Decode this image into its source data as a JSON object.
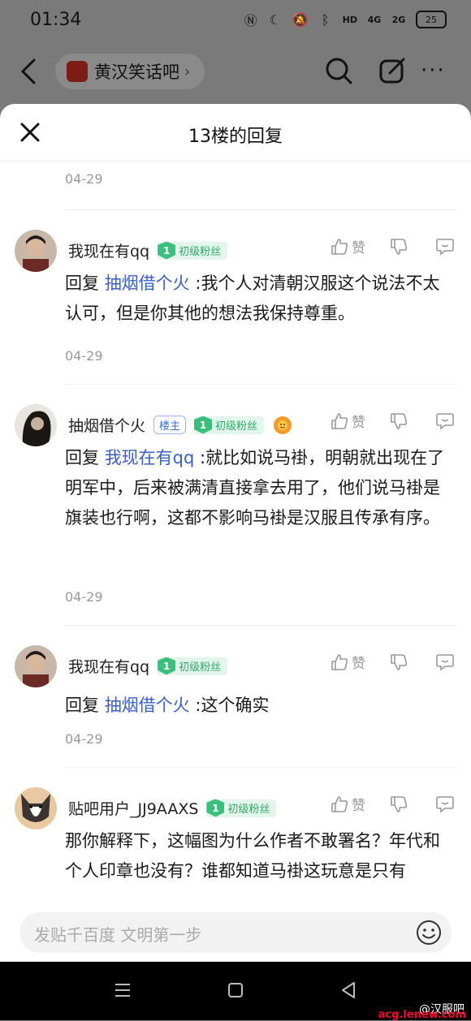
{
  "status_bar": {
    "time": "01:34",
    "net1": "4G",
    "net2": "2G",
    "battery": "25",
    "hd": "HD"
  },
  "topnav": {
    "forum_name": "黄汉笑话吧",
    "chevron": "›",
    "more": "···"
  },
  "sheet": {
    "title": "13楼的回复",
    "top_date": "04-29"
  },
  "comments": [
    {
      "username": "我现在有qq",
      "fan_level": "1",
      "fan_label": "初级粉丝",
      "like_label": "赞",
      "reply_prefix": "回复",
      "mention": "抽烟借个火",
      "text": ":我个人对清朝汉服这个说法不太认可，但是你其他的想法我保持尊重。",
      "date": "04-29"
    },
    {
      "username": "抽烟借个火",
      "owner_badge": "楼主",
      "fan_level": "1",
      "fan_label": "初级粉丝",
      "like_label": "赞",
      "reply_prefix": "回复",
      "mention": "我现在有qq",
      "text": ":就比如说马褂，明朝就出现在了明军中，后来被满清直接拿去用了，他们说马褂是旗装也行啊，这都不影响马褂是汉服且传承有序。",
      "date": "04-29"
    },
    {
      "username": "我现在有qq",
      "fan_level": "1",
      "fan_label": "初级粉丝",
      "like_label": "赞",
      "reply_prefix": "回复",
      "mention": "抽烟借个火",
      "text": ":这个确实",
      "date": "04-29"
    },
    {
      "username": "贴吧用户_JJ9AAXS",
      "fan_level": "1",
      "fan_label": "初级粉丝",
      "like_label": "赞",
      "text": "那你解释下，这幅图为什么作者不敢署名？年代和个人印章也没有？谁都知道马褂这玩意是只有"
    }
  ],
  "input": {
    "placeholder": "发贴千百度 文明第一步"
  },
  "watermark": {
    "text": "@汉服吧",
    "site": "acg.lenew.com"
  },
  "colors": {
    "mention": "#3b5fc0",
    "fan_green": "#3bbf7c",
    "overlay": "#7a7a7a"
  }
}
